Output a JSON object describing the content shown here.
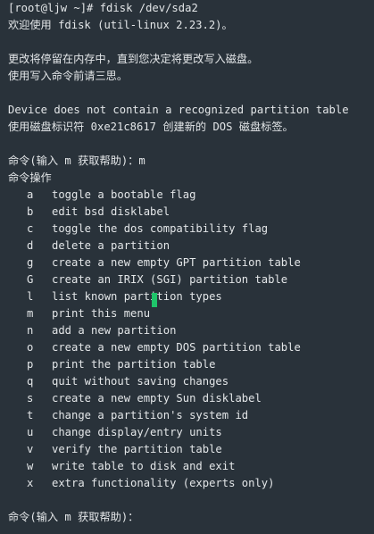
{
  "terminal": {
    "lines": [
      "[root@ljw ~]# fdisk /dev/sda2",
      "欢迎使用 fdisk (util-linux 2.23.2)。",
      "更改将停留在内存中，直到您决定将更改写入磁盘。",
      "使用写入命令前请三思。",
      "Device does not contain a recognized partition table",
      "使用磁盘标识符 0xe21c8617 创建新的 DOS 磁盘标签。",
      "命令(输入 m 获取帮助)：m",
      "命令操作"
    ],
    "menu": [
      {
        "key": "a",
        "desc": "toggle a bootable flag"
      },
      {
        "key": "b",
        "desc": "edit bsd disklabel"
      },
      {
        "key": "c",
        "desc": "toggle the dos compatibility flag"
      },
      {
        "key": "d",
        "desc": "delete a partition"
      },
      {
        "key": "g",
        "desc": "create a new empty GPT partition table"
      },
      {
        "key": "G",
        "desc": "create an IRIX (SGI) partition table"
      },
      {
        "key": "l",
        "desc": "list known partition types"
      },
      {
        "key": "m",
        "desc": "print this menu"
      },
      {
        "key": "n",
        "desc": "add a new partition"
      },
      {
        "key": "o",
        "desc": "create a new empty DOS partition table"
      },
      {
        "key": "p",
        "desc": "print the partition table"
      },
      {
        "key": "q",
        "desc": "quit without saving changes"
      },
      {
        "key": "s",
        "desc": "create a new empty Sun disklabel"
      },
      {
        "key": "t",
        "desc": "change a partition's system id"
      },
      {
        "key": "u",
        "desc": "change display/entry units"
      },
      {
        "key": "v",
        "desc": "verify the partition table"
      },
      {
        "key": "w",
        "desc": "write table to disk and exit"
      },
      {
        "key": "x",
        "desc": "extra functionality (experts only)"
      }
    ],
    "final_prompt": "命令(输入 m 获取帮助)："
  },
  "colors": {
    "background": "#29323a",
    "text": "#e3e6e8",
    "cursor": "#1fc46a"
  }
}
